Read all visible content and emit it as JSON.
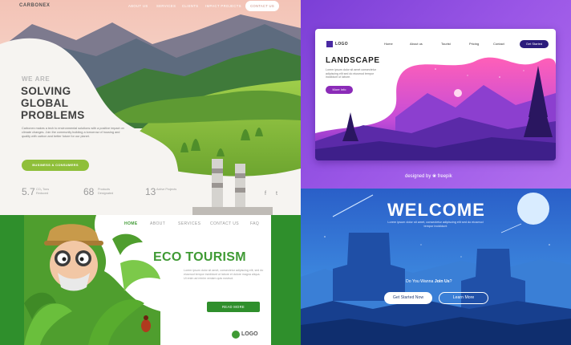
{
  "panel1": {
    "logo": "CARBONEX",
    "nav": [
      "ABOUT US",
      "SERVICES",
      "CLIENTS",
      "IMPACT PROJECTS"
    ],
    "contact": "CONTACT US",
    "kicker": "WE ARE",
    "title_lines": [
      "SOLVING",
      "GLOBAL",
      "PROBLEMS"
    ],
    "description": "Carbonex makes a tech to environmental solutions with a positive impact on climate changes. Join the community building a tomorrow of housing and quality with carbon and better future for our planet.",
    "cta": "BUSINESS & CONSUMERS",
    "stats": [
      {
        "num": "5.7",
        "label": "CO₂ Tons Reduced"
      },
      {
        "num": "68",
        "label": "Products Designated"
      },
      {
        "num": "13",
        "label": "Active Projects"
      }
    ],
    "social": [
      "f",
      "t"
    ]
  },
  "panel2": {
    "logo": "LOGO",
    "nav": [
      "Home",
      "About us",
      "Tourist",
      "Pricing",
      "Contact"
    ],
    "get_started": "Get Started",
    "title": "LANDSCAPE",
    "description": "Lorem ipsum dolor sit amet consectetur adipiscing elit sed do eiusmod tempor incididunt ut labore.",
    "button": "More Info",
    "credit": "designed by ❀ freepik"
  },
  "panel3": {
    "nav": [
      "HOME",
      "ABOUT",
      "SERVICES",
      "CONTACT US",
      "FAQ"
    ],
    "title": "ECO TOURISM",
    "description": "Lorem ipsum dolor sit amet, consectetur adipiscing elit, sed do eiusmod tempor incididunt ut labore et dolore magna aliqua. Ut enim ad minim veniam quis nostrud.",
    "button": "READ MORE",
    "logo": "LOGO"
  },
  "panel4": {
    "title": "WELCOME",
    "subtitle": "Lorem ipsum dolor sit amet, consectetur adipiscing elit sed do eiusmod tempor incididunt",
    "join_prefix": "Do You Wanna",
    "join_link": "Join Us",
    "join_suffix": "?",
    "btn_primary": "Get Started Now",
    "btn_secondary": "Learn More"
  },
  "colors": {
    "carbonex_green": "#8fbf3a",
    "landscape_purple": "#7b3fd6",
    "eco_green": "#2f8f2c",
    "welcome_blue": "#2f6fd0"
  }
}
